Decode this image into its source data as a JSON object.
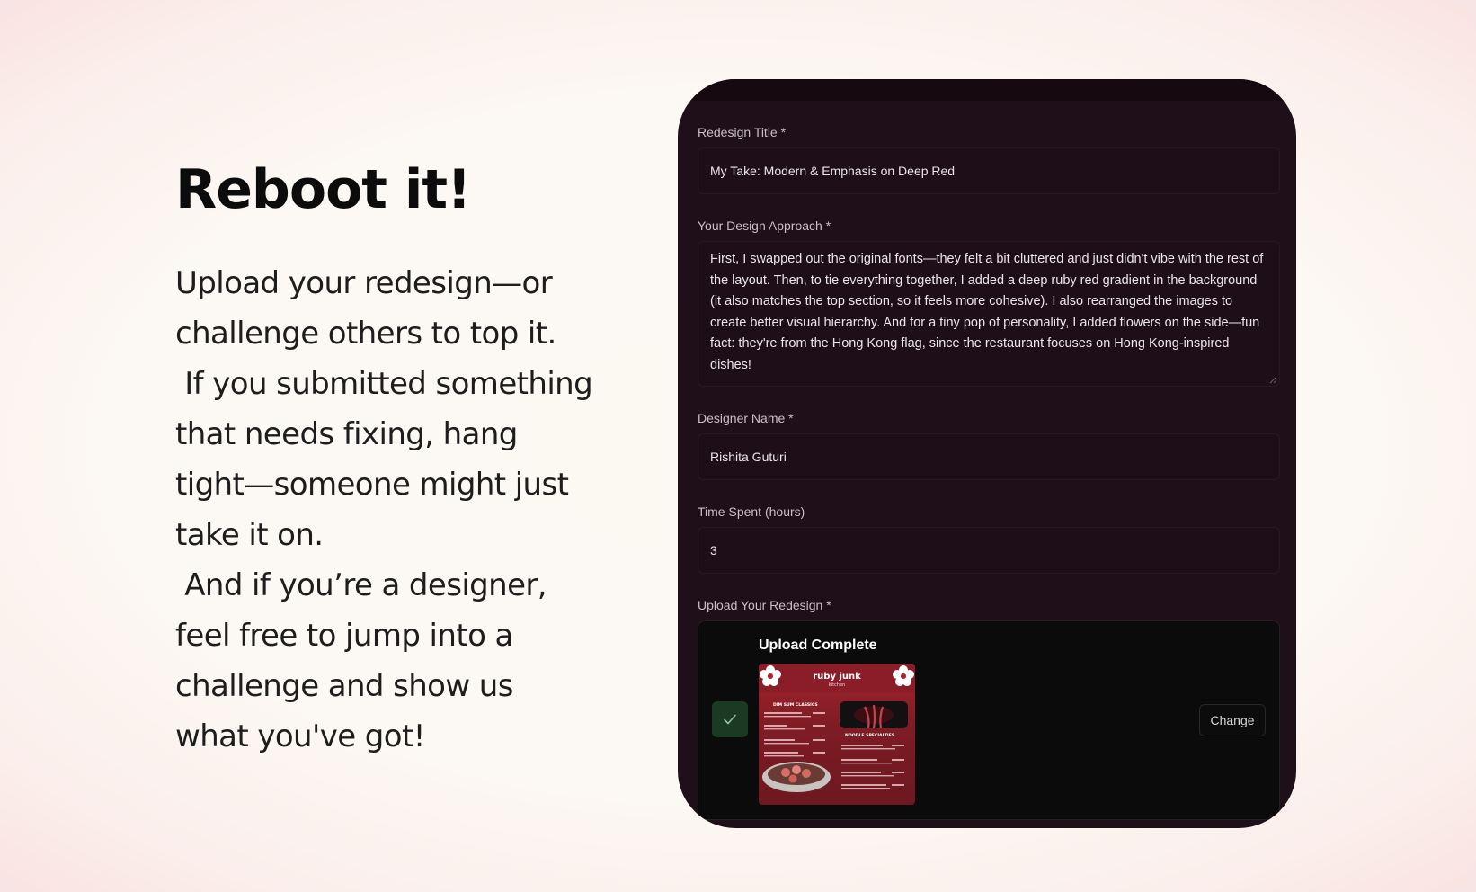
{
  "hero": {
    "headline": "Reboot it!",
    "blurb": "Upload your redesign—or\nchallenge others to top it.\n If you submitted something\nthat needs fixing, hang\ntight—someone might just\ntake it on.\n And if you’re a designer,\nfeel free to jump into a\nchallenge and show us\nwhat you've got!"
  },
  "form": {
    "title_label": "Redesign Title *",
    "title_value": "My Take: Modern & Emphasis on Deep Red",
    "approach_label": "Your Design Approach *",
    "approach_value": "First, I swapped out the original fonts—they felt a bit cluttered and just didn't vibe with the rest of the layout. Then, to tie everything together, I added a deep ruby red gradient in the background (it also matches the top section, so it feels more cohesive). I also rearranged the images to create better visual hierarchy. And for a tiny pop of personality, I added flowers on the side—fun fact: they're from the Hong Kong flag, since the restaurant focuses on Hong Kong-inspired dishes!",
    "designer_label": "Designer Name *",
    "designer_value": "Rishita Guturi",
    "time_label": "Time Spent (hours)",
    "time_value": "3",
    "upload_label": "Upload Your Redesign *",
    "upload_status": "Upload Complete",
    "change_label": "Change"
  },
  "thumbnail": {
    "brand": "ruby junk",
    "brand_sub": "kitchen",
    "section_left": "DIM SUM CLASSICS",
    "section_right": "NOODLE SPECIALTIES"
  },
  "colors": {
    "accent": "#1b3a24",
    "panel": "#1f0f18",
    "menu_red": "#a4232e"
  },
  "icons": {
    "check": "check-icon",
    "flower": "bauhinia-flower-icon",
    "resize": "resize-handle-icon"
  }
}
